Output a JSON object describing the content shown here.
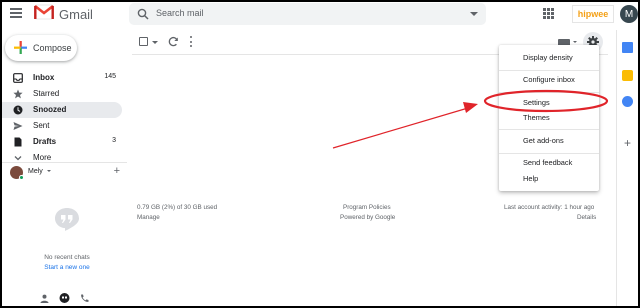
{
  "header": {
    "app_name": "Gmail",
    "search_placeholder": "Search mail",
    "brand_badge": "hipwee",
    "avatar_initial": "M"
  },
  "sidebar": {
    "compose_label": "Compose",
    "items": [
      {
        "label": "Inbox",
        "count": "145",
        "icon": "inbox-icon",
        "bold": true
      },
      {
        "label": "Starred",
        "count": "",
        "icon": "star-icon",
        "bold": false
      },
      {
        "label": "Snoozed",
        "count": "",
        "icon": "clock-icon",
        "bold": true
      },
      {
        "label": "Sent",
        "count": "",
        "icon": "send-icon",
        "bold": false
      },
      {
        "label": "Drafts",
        "count": "3",
        "icon": "draft-icon",
        "bold": true
      },
      {
        "label": "More",
        "count": "",
        "icon": "chevron-down-icon",
        "bold": false
      }
    ]
  },
  "hangouts": {
    "user_name": "Mely",
    "no_chats": "No recent chats",
    "start_chat": "Start a new one"
  },
  "footer": {
    "storage": "0.79 GB (2%) of 30 GB used",
    "manage": "Manage",
    "policies": "Program Policies",
    "powered": "Powered by Google",
    "activity": "Last account activity: 1 hour ago",
    "details": "Details"
  },
  "settings_menu": {
    "items": [
      "Display density",
      "Configure inbox",
      "Settings",
      "Themes",
      "Get add-ons",
      "Send feedback",
      "Help"
    ]
  },
  "colors": {
    "annotation_red": "#e0242a",
    "gmail_red": "#ea4335",
    "link_blue": "#1a73e8"
  }
}
